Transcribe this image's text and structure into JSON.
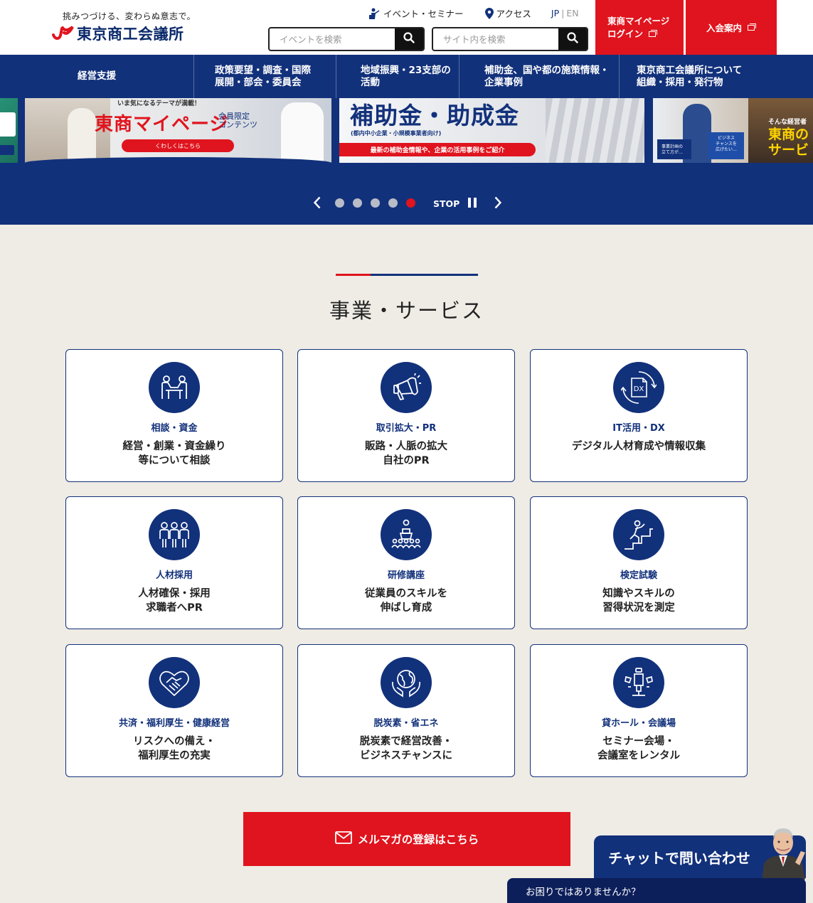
{
  "header": {
    "tagline": "挑みつづける、変わらぬ意志で。",
    "logo_text": "東京商工会議所",
    "event_link": "イベント・セミナー",
    "access_link": "アクセス",
    "lang_jp": "JP",
    "lang_sep": "|",
    "lang_en": "EN",
    "search_event_placeholder": "イベントを検索",
    "search_site_placeholder": "サイト内を検索",
    "mypage_line1": "東商マイページ",
    "mypage_line2": "ログイン",
    "join_label": "入会案内"
  },
  "nav": [
    {
      "line1": "経営支援",
      "line2": ""
    },
    {
      "line1": "政策要望・調査・国際",
      "line2": "展開・部会・委員会"
    },
    {
      "line1": "地域振興・23支部の",
      "line2": "活動"
    },
    {
      "line1": "補助金、国や都の施策情報・",
      "line2": "企業事例"
    },
    {
      "line1": "東京商工会議所について",
      "line2": "組織・採用・発行物"
    }
  ],
  "carousel": {
    "slide2": {
      "top_text": "いま気になるテーマが満載！",
      "title": "東商マイページ",
      "badge_line1": "会員限定",
      "badge_line2": "コンテンツ",
      "button": "くわしくはこちら"
    },
    "slide3": {
      "title": "補助金・助成金",
      "subtitle": "(都内中小企業・小規模事業者向け)",
      "button": "最新の補助金情報や、企業の活用事例をご紹介"
    },
    "slide4": {
      "small1": "そんな経営者",
      "title_line1": "東商の",
      "title_line2": "サービ",
      "chip1_line1": "事業計画の",
      "chip1_line2": "立て方が…",
      "chip2_line1": "ビジネス",
      "chip2_line2": "チャンスを",
      "chip2_line3": "広げたい…"
    },
    "stop_label": "STOP",
    "dot_count": 5,
    "active_dot": 5
  },
  "section": {
    "title": "事業・サービス"
  },
  "services": [
    {
      "icon": "consultation-icon",
      "category": "相談・資金",
      "desc1": "経営・創業・資金繰り",
      "desc2": "等について相談"
    },
    {
      "icon": "megaphone-icon",
      "category": "取引拡大・PR",
      "desc1": "販路・人脈の拡大",
      "desc2": "自社のPR"
    },
    {
      "icon": "dx-icon",
      "category": "IT活用・DX",
      "desc1": "デジタル人材育成や情報収集",
      "desc2": ""
    },
    {
      "icon": "people-group-icon",
      "category": "人材採用",
      "desc1": "人材確保・採用",
      "desc2": "求職者へPR"
    },
    {
      "icon": "lecture-icon",
      "category": "研修講座",
      "desc1": "従業員のスキルを",
      "desc2": "伸ばし育成"
    },
    {
      "icon": "stairs-climb-icon",
      "category": "検定試験",
      "desc1": "知識やスキルの",
      "desc2": "習得状況を測定"
    },
    {
      "icon": "handshake-heart-icon",
      "category": "共済・福利厚生・健康経営",
      "desc1": "リスクへの備え・",
      "desc2": "福利厚生の充実"
    },
    {
      "icon": "earth-hands-icon",
      "category": "脱炭素・省エネ",
      "desc1": "脱炭素で経営改善・",
      "desc2": "ビジネスチャンスに"
    },
    {
      "icon": "microphone-hall-icon",
      "category": "貸ホール・会議場",
      "desc1": "セミナー会場・",
      "desc2": "会議室をレンタル"
    }
  ],
  "mail_button": "メルマガの登録はこちら",
  "chat": {
    "banner": "チャットで問い合わせ",
    "footer": "お困りではありませんか？"
  },
  "colors": {
    "navy": "#12317b",
    "red": "#e0141e",
    "background": "#efece5"
  }
}
